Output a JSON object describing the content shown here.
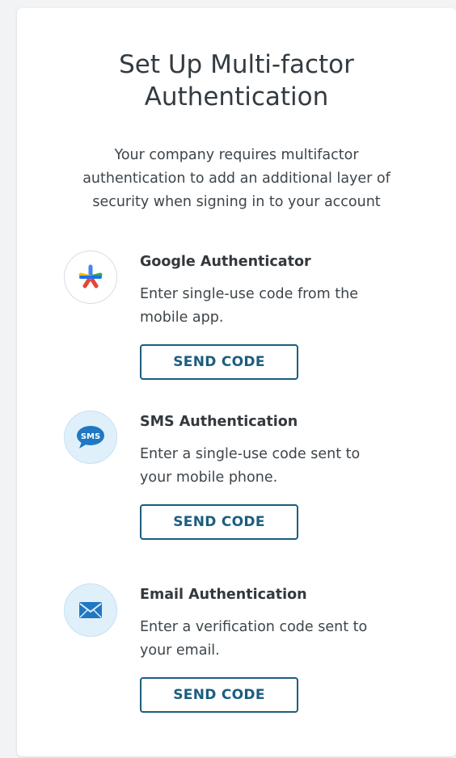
{
  "header": {
    "title_line1": "Set Up Multi-factor",
    "title_line2": "Authentication",
    "subtitle_line1": "Your company requires multifactor",
    "subtitle_line2": "authentication to add an additional layer of",
    "subtitle_line3": "security when signing in to your account"
  },
  "methods": [
    {
      "name": "Google Authenticator",
      "desc_line1": "Enter single-use code from the",
      "desc_line2": "mobile app.",
      "button": "SEND CODE",
      "icon": "google-authenticator-icon"
    },
    {
      "name": "SMS Authentication",
      "desc_line1": "Enter a single-use code sent to",
      "desc_line2": "your mobile phone.",
      "button": "SEND CODE",
      "icon": "sms-icon",
      "icon_text": "SMS"
    },
    {
      "name": "Email Authentication",
      "desc_line1": "Enter a verification code sent to",
      "desc_line2": "your email.",
      "button": "SEND CODE",
      "icon": "email-envelope-icon"
    }
  ],
  "colors": {
    "button_border": "#1b5d7f",
    "icon_blue": "#1f78c1",
    "icon_bg": "#dff0fb"
  }
}
